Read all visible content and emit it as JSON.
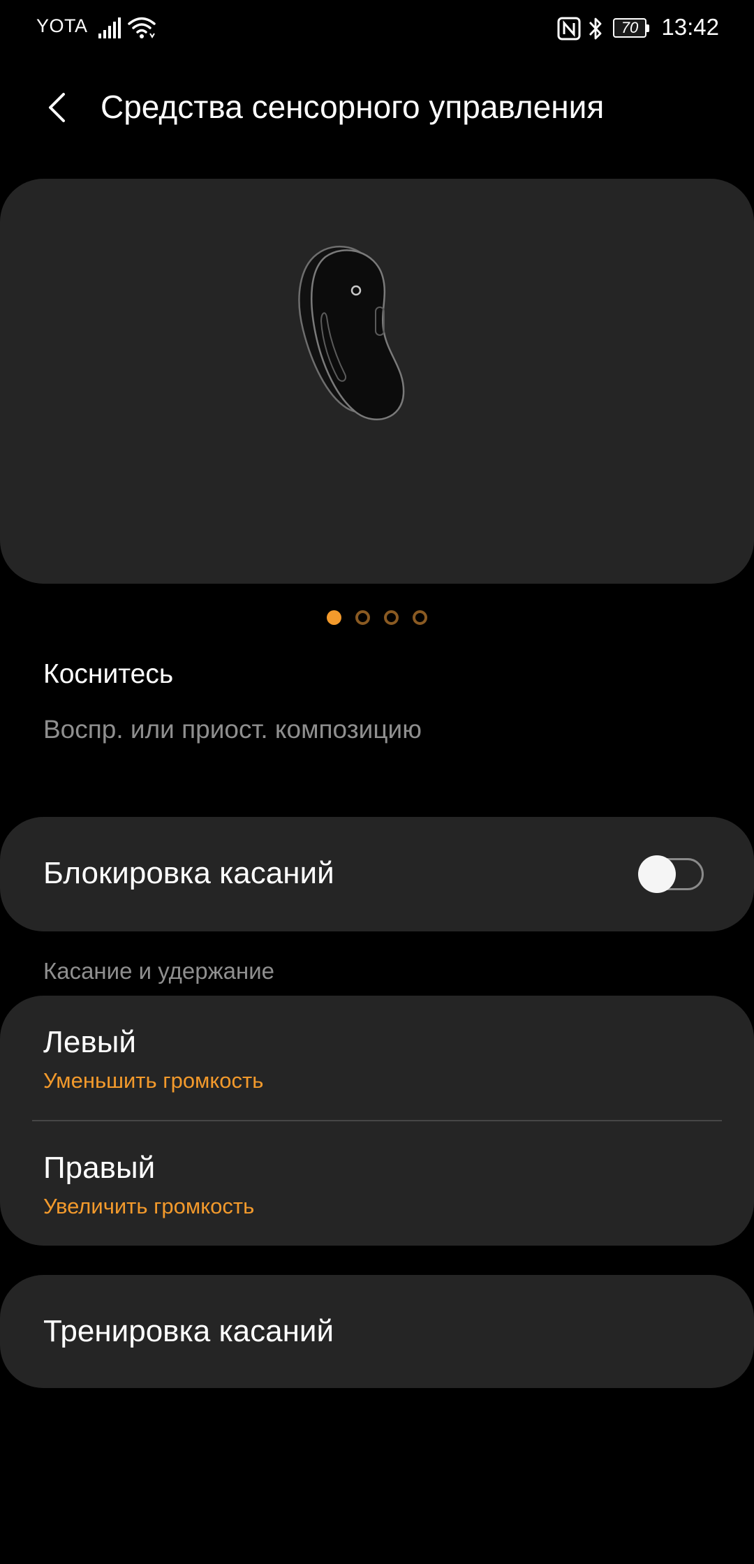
{
  "status_bar": {
    "carrier": "YOTA",
    "battery_level": "70",
    "time": "13:42"
  },
  "header": {
    "title": "Средства сенсорного управления",
    "back_icon": "chevron-left-icon"
  },
  "pager": {
    "count": 4,
    "active_index": 0,
    "active_color": "#f39a2c",
    "inactive_color": "#8a5a22"
  },
  "tap": {
    "title": "Коснитесь",
    "description": "Воспр. или приост. композицию"
  },
  "touch_lock": {
    "label": "Блокировка касаний",
    "enabled": false
  },
  "touch_and_hold": {
    "header": "Касание и удержание",
    "left": {
      "title": "Левый",
      "value": "Уменьшить громкость"
    },
    "right": {
      "title": "Правый",
      "value": "Увеличить громкость"
    }
  },
  "training": {
    "label": "Тренировка касаний"
  },
  "colors": {
    "background": "#000000",
    "card": "#252525",
    "accent": "#f39a2c",
    "secondary_text": "#8f8f8f"
  }
}
